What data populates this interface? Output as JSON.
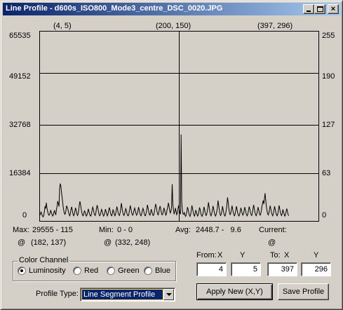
{
  "window": {
    "title": "Line Profile - d600s_ISO800_Mode3_centre_DSC_0020.JPG",
    "controls": {
      "minimize": "minimize-icon",
      "maximize": "maximize-icon",
      "close": "×"
    }
  },
  "plot_header": {
    "left": "(4, 5)",
    "center": "(200, 150)",
    "right": "(397, 296)"
  },
  "chart_data": {
    "type": "line",
    "left_axis_ticks": [
      "65535",
      "49152",
      "32768",
      "16384",
      "0"
    ],
    "right_axis_ticks": [
      "255",
      "190",
      "127",
      "63",
      "0"
    ],
    "ylim": [
      0,
      65535
    ],
    "xlim": [
      0,
      440
    ],
    "grid": true,
    "series": [
      {
        "values": [
          1100,
          1500,
          2200,
          2600,
          1800,
          1300,
          900,
          1400,
          2800,
          4600,
          3800,
          5800,
          4100,
          3000,
          2000,
          1500,
          1600,
          2300,
          3300,
          2400,
          1800,
          1200,
          1500,
          2600,
          3100,
          2200,
          1600,
          3500,
          4600,
          6400,
          5500,
          4500,
          10800,
          12500,
          11600,
          9400,
          7600,
          5400,
          3700,
          2500,
          1800,
          2100,
          3300,
          4800,
          4200,
          3500,
          2600,
          1700,
          1300,
          2200,
          3600,
          4400,
          3100,
          1900,
          1300,
          1700,
          2900,
          4100,
          3200,
          2100,
          1400,
          1800,
          3200,
          5200,
          6300,
          5100,
          3600,
          2300,
          1500,
          1300,
          2100,
          3000,
          2600,
          1800,
          1200,
          1600,
          2400,
          3700,
          2900,
          2000,
          1400,
          1200,
          2000,
          3300,
          4300,
          3600,
          2300,
          1600,
          1400,
          2400,
          3900,
          5000,
          4100,
          2800,
          1800,
          1300,
          1700,
          2700,
          3500,
          2700,
          1800,
          1200,
          1500,
          2400,
          3600,
          2900,
          1900,
          1300,
          1800,
          3000,
          4200,
          3400,
          2200,
          1500,
          1300,
          2300,
          3500,
          2800,
          1800,
          1300,
          1900,
          3100,
          4500,
          3600,
          2400,
          1600,
          1400,
          2300,
          3700,
          5700,
          4300,
          2800,
          1900,
          1400,
          1800,
          2900,
          3800,
          3100,
          2000,
          1400,
          1300,
          2200,
          3400,
          4900,
          3900,
          2600,
          1800,
          1500,
          2100,
          3300,
          4000,
          3100,
          2100,
          1500,
          1900,
          3000,
          4300,
          3400,
          2300,
          1600,
          1300,
          2000,
          3100,
          3900,
          3200,
          2100,
          1400,
          1300,
          2200,
          3500,
          5100,
          4000,
          2700,
          1800,
          1500,
          2300,
          3600,
          2800,
          1900,
          1400,
          1600,
          2700,
          4100,
          5400,
          4300,
          2900,
          1900,
          1600,
          2500,
          3900,
          4700,
          3500,
          2300,
          1600,
          1800,
          2900,
          4100,
          3300,
          2200,
          1500,
          2100,
          3500,
          4400,
          5800,
          4600,
          3200,
          2300,
          2900,
          4400,
          12300,
          5400,
          3300,
          2000,
          2600,
          4000,
          2900,
          1700,
          2300,
          3600,
          4900,
          3700,
          2500,
          1800,
          29555,
          6200,
          3100,
          2000,
          1800,
          2400,
          1500,
          1100,
          1600,
          2800,
          4300,
          3600,
          2400,
          1500,
          1100,
          1800,
          3200,
          4900,
          3800,
          2500,
          1600,
          1200,
          2000,
          3300,
          2600,
          1700,
          1200,
          1700,
          2900,
          4200,
          3400,
          2200,
          1400,
          1100,
          1800,
          3100,
          4400,
          3300,
          2100,
          1400,
          1600,
          2800,
          4100,
          6000,
          4500,
          2900,
          1800,
          1300,
          1900,
          3100,
          4700,
          3900,
          2600,
          1700,
          1200,
          1700,
          2700,
          4000,
          6600,
          5100,
          3400,
          2100,
          1400,
          1800,
          3000,
          4600,
          3500,
          2300,
          1500,
          1200,
          2000,
          3300,
          5200,
          7700,
          6000,
          3900,
          2500,
          1700,
          2200,
          3500,
          4800,
          3600,
          2400,
          1600,
          1300,
          2100,
          3300,
          4600,
          3500,
          2300,
          1500,
          1200,
          1800,
          2900,
          4100,
          3100,
          2100,
          1500,
          1900,
          3000,
          4300,
          3400,
          2300,
          1600,
          1300,
          2000,
          3200,
          4500,
          3600,
          2400,
          1700,
          1400,
          2300,
          3700,
          5100,
          3800,
          2600,
          1700,
          1300,
          1900,
          3100,
          4300,
          3300,
          2200,
          1500,
          1800,
          2900,
          4500,
          5500,
          6600,
          5400,
          7200,
          9100,
          6800,
          4700,
          3200,
          2100,
          1600,
          2300,
          3600,
          4800,
          3700,
          2500,
          1700,
          1300,
          2000,
          3300,
          4600,
          3500,
          2400,
          1600,
          1300,
          2100,
          3400,
          4900,
          3700,
          2500,
          1700,
          1400,
          2200,
          3500,
          2700,
          1800,
          1200,
          1600,
          2600,
          3800,
          2900,
          1900,
          1300
        ]
      }
    ]
  },
  "stats": {
    "max_label": "Max:",
    "max_value": "29555 - 115",
    "max_at": "@",
    "max_pos": "(182, 137)",
    "min_label": "Min:",
    "min_value": "0 - 0",
    "min_at": "@",
    "min_pos": "(332, 248)",
    "avg_label": "Avg:",
    "avg_value": "2448.7 -   9.6",
    "current_label": "Current:",
    "current_at": "@"
  },
  "color_channel": {
    "legend": "Color Channel",
    "options": [
      "Luminosity",
      "Red",
      "Green",
      "Blue"
    ],
    "selected": "Luminosity"
  },
  "coords": {
    "from_label": "From:",
    "to_label": "To:",
    "x_label": "X",
    "y_label": "Y",
    "from_x": "4",
    "from_y": "5",
    "to_x": "397",
    "to_y": "296"
  },
  "profile_type": {
    "label": "Profile Type:",
    "value": "Line Segment Profile"
  },
  "buttons": {
    "apply": "Apply New (X,Y)",
    "save": "Save Profile"
  }
}
